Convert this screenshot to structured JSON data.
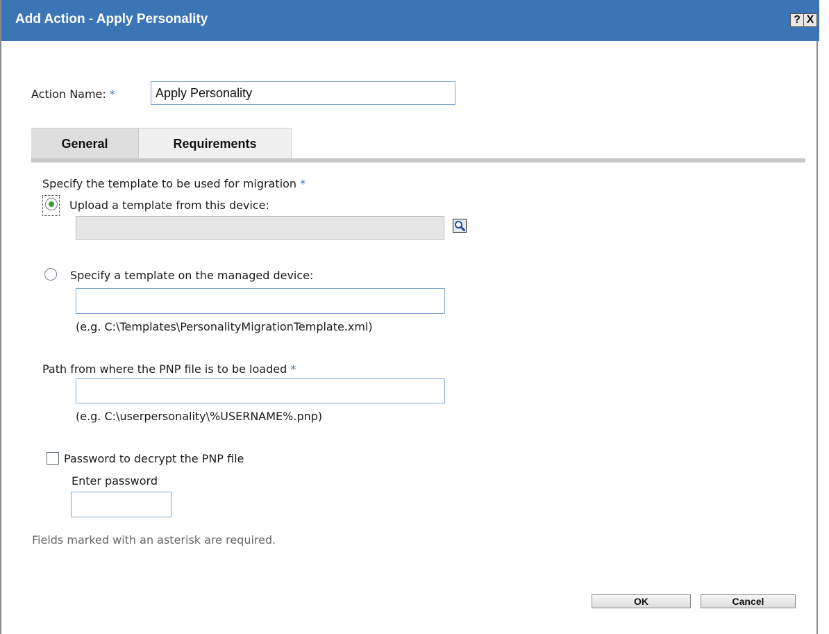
{
  "window": {
    "title": "Add Action - Apply Personality",
    "help_label": "?",
    "close_label": "X"
  },
  "action_name": {
    "label": "Action Name:",
    "required_mark": "*",
    "value": "Apply Personality"
  },
  "tabs": [
    {
      "label": "General",
      "selected": true
    },
    {
      "label": "Requirements",
      "selected": false
    }
  ],
  "general": {
    "template_heading": "Specify the template to be used for migration",
    "template_required_mark": "*",
    "upload_option": {
      "label": "Upload a template from this device:",
      "selected": true,
      "value": ""
    },
    "browse_icon": "magnifier-icon",
    "managed_option": {
      "label": "Specify a template on the managed device:",
      "selected": false,
      "value": "",
      "example": "(e.g. C:\\Templates\\PersonalityMigrationTemplate.xml)"
    },
    "pnp_path": {
      "label": "Path from where the PNP file is to be loaded",
      "required_mark": "*",
      "value": "",
      "example": "(e.g. C:\\userpersonality\\%USERNAME%.pnp)"
    },
    "password": {
      "checkbox_label": "Password to decrypt the PNP file",
      "checked": false,
      "field_label": "Enter password",
      "value": ""
    }
  },
  "required_note": "Fields marked with an asterisk are required.",
  "buttons": {
    "ok": "OK",
    "cancel": "Cancel"
  },
  "colors": {
    "title_bar": "#3b75b5",
    "accent": "#3b75b5",
    "radio_selected": "#2fa52f"
  }
}
